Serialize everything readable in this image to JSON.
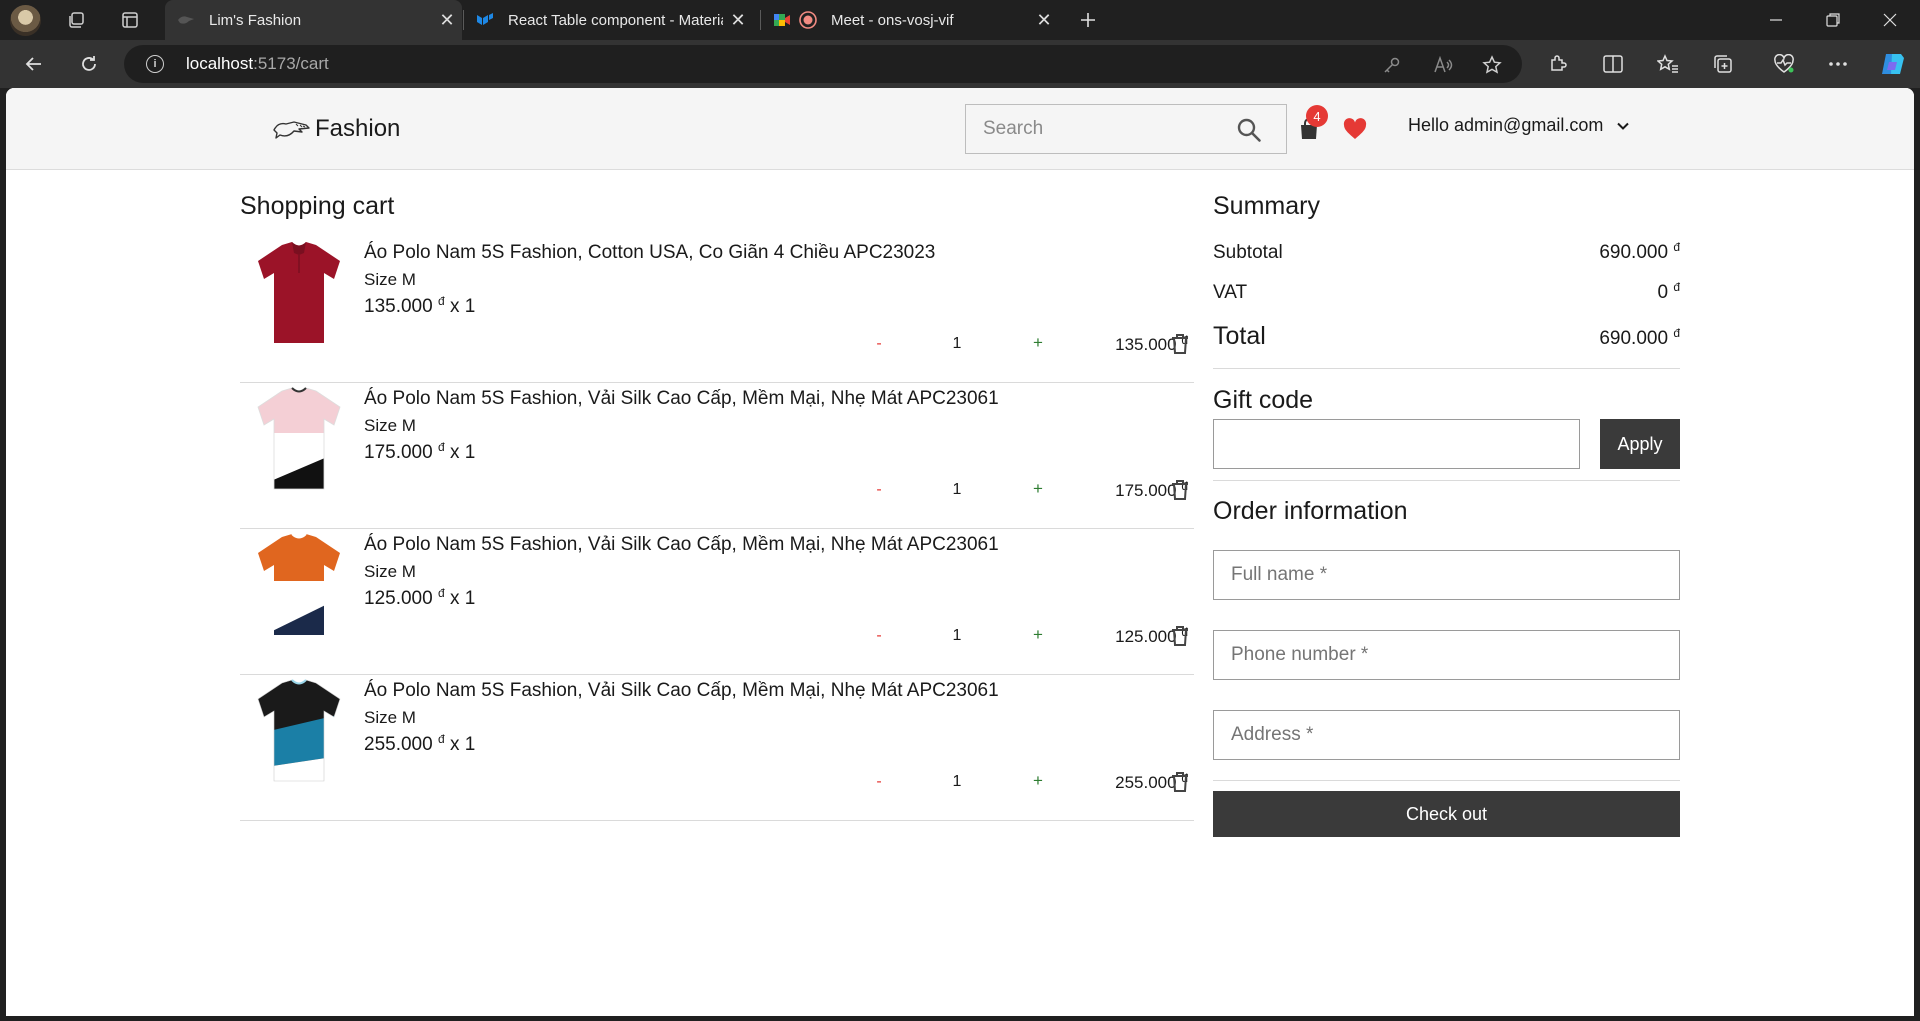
{
  "browser": {
    "tabs": [
      {
        "title": "Lim's Fashion",
        "active": true
      },
      {
        "title": "React Table component - Materia",
        "active": false
      },
      {
        "title": "Meet - ons-vosj-vif",
        "active": false
      }
    ],
    "url_host": "localhost",
    "url_path": ":5173/cart"
  },
  "header": {
    "brand": "Fashion",
    "search_placeholder": "Search",
    "cart_count": "4",
    "user_greeting": "Hello admin@gmail.com"
  },
  "cart": {
    "title": "Shopping cart",
    "currency": "đ",
    "items": [
      {
        "name": "Áo Polo Nam 5S Fashion, Cotton USA, Co Giãn 4 Chiều APC23023",
        "size": "Size M",
        "price": "135.000",
        "qty_text": "x 1",
        "qty": "1",
        "line_total": "135.000",
        "colors": [
          "#9b1328"
        ]
      },
      {
        "name": "Áo Polo Nam 5S Fashion, Vải Silk Cao Cấp, Mềm Mại, Nhẹ Mát APC23061",
        "size": "Size M",
        "price": "175.000",
        "qty_text": "x 1",
        "qty": "1",
        "line_total": "175.000",
        "colors": [
          "#f4cfd5",
          "#ffffff",
          "#111111"
        ]
      },
      {
        "name": "Áo Polo Nam 5S Fashion, Vải Silk Cao Cấp, Mềm Mại, Nhẹ Mát APC23061",
        "size": "Size M",
        "price": "125.000",
        "qty_text": "x 1",
        "qty": "1",
        "line_total": "125.000",
        "colors": [
          "#e0661f",
          "#ffffff",
          "#1b2a4a"
        ]
      },
      {
        "name": "Áo Polo Nam 5S Fashion, Vải Silk Cao Cấp, Mềm Mại, Nhẹ Mát APC23061",
        "size": "Size M",
        "price": "255.000",
        "qty_text": "x 1",
        "qty": "1",
        "line_total": "255.000",
        "colors": [
          "#1a1a1a",
          "#1b7fa6",
          "#ffffff"
        ]
      }
    ],
    "minus_label": "-",
    "plus_label": "+"
  },
  "summary": {
    "title": "Summary",
    "subtotal_label": "Subtotal",
    "subtotal_value": "690.000",
    "vat_label": "VAT",
    "vat_value": "0",
    "total_label": "Total",
    "total_value": "690.000",
    "gift_title": "Gift code",
    "gift_value": "",
    "apply_label": "Apply",
    "order_title": "Order information",
    "fullname_placeholder": "Full name *",
    "phone_placeholder": "Phone number *",
    "address_placeholder": "Address *",
    "checkout_label": "Check out"
  },
  "colors": {
    "badge": "#e53935",
    "minus": "#e53935",
    "plus": "#2e7d32",
    "button": "#3a3a3a",
    "heart": "#e53935"
  }
}
